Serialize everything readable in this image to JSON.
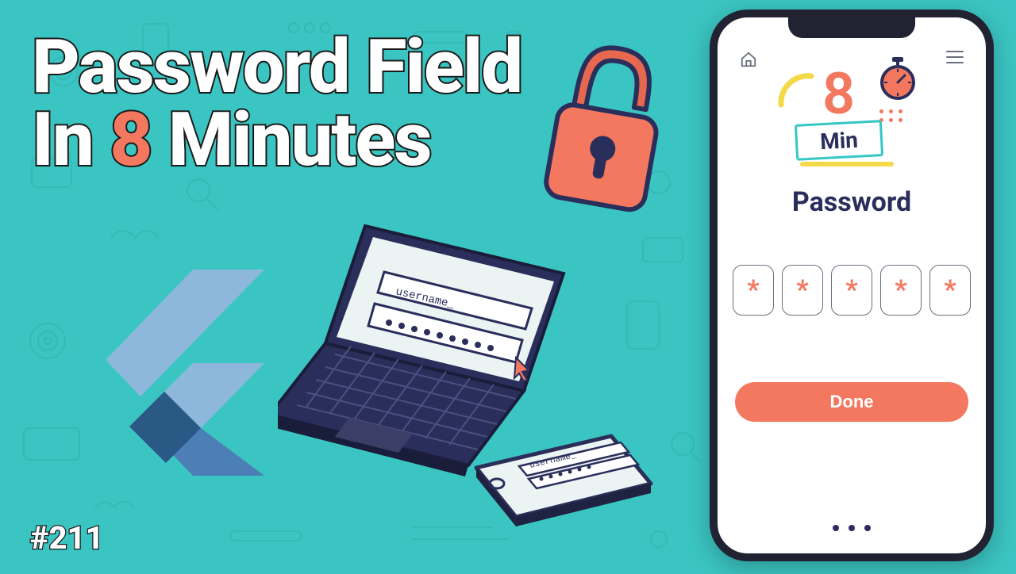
{
  "title": {
    "line1": "Password Field",
    "line2_a": "In ",
    "line2_accent": "8",
    "line2_b": " Minutes"
  },
  "episode": "#211",
  "phone": {
    "badge_number": "8",
    "badge_label": "Min",
    "password_title": "Password",
    "pin_char": "*",
    "pin_count": 5,
    "done_label": "Done"
  },
  "laptop": {
    "username_placeholder": "username_"
  },
  "miniphone": {
    "username_placeholder": "username_"
  },
  "colors": {
    "bg": "#3bc5c2",
    "accent": "#f3785f",
    "dark": "#2a2e5b",
    "flutter_light": "#8db8dc",
    "flutter_dark": "#3e6ea0"
  }
}
